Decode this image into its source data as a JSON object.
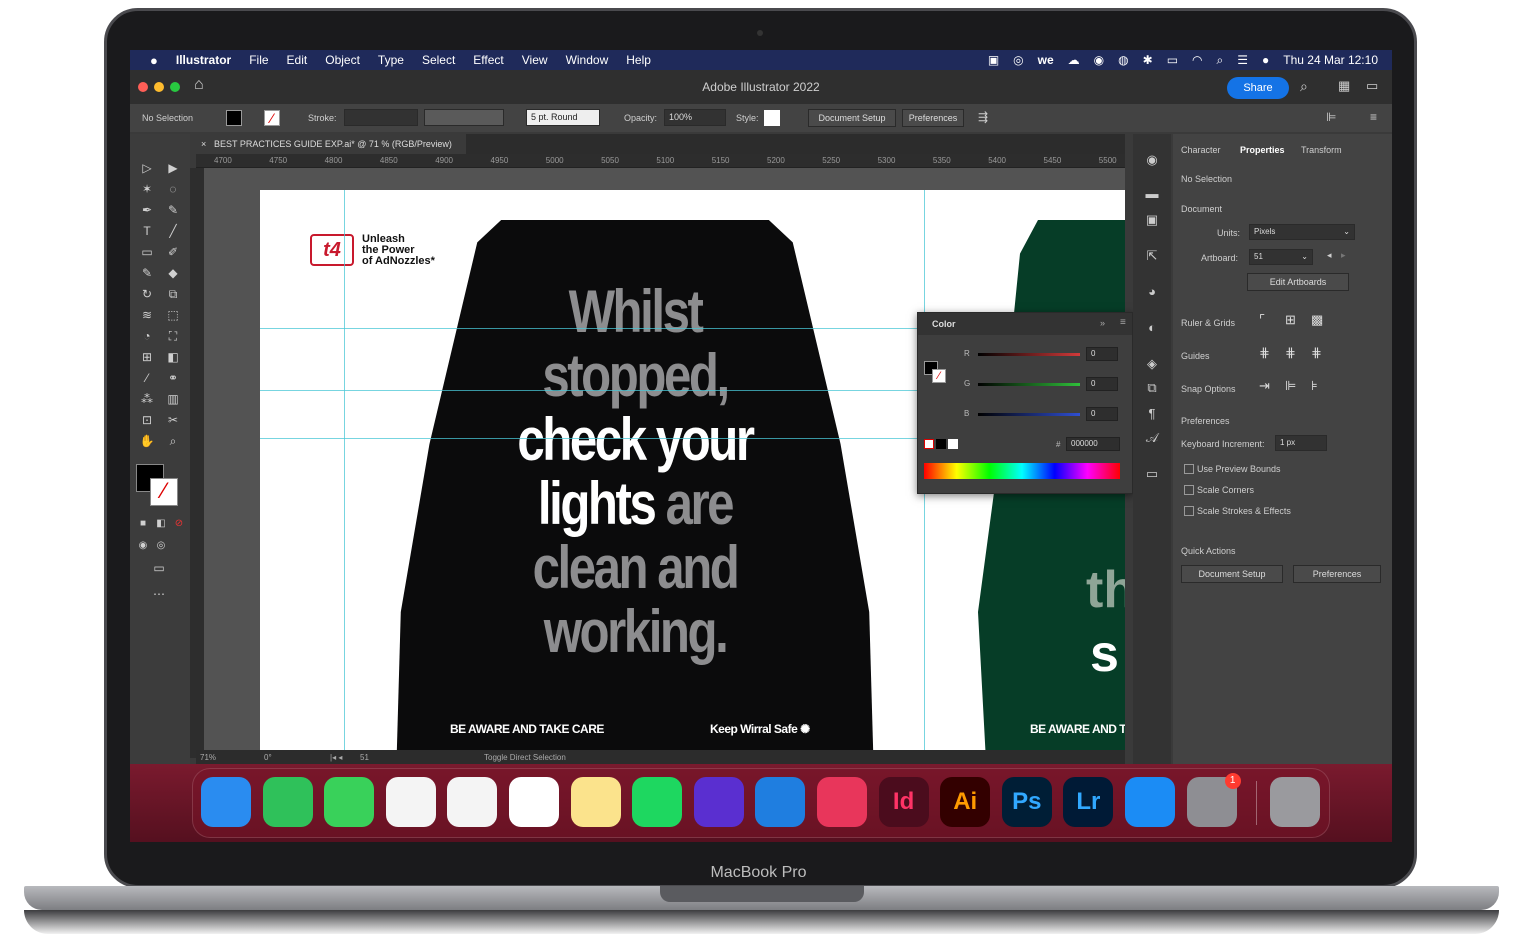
{
  "device": {
    "brand_label": "MacBook Pro"
  },
  "menubar": {
    "apple": "",
    "items": [
      "Illustrator",
      "File",
      "Edit",
      "Object",
      "Type",
      "Select",
      "Effect",
      "View",
      "Window",
      "Help"
    ],
    "datetime": "Thu 24 Mar  12:10"
  },
  "titlebar": {
    "title": "Adobe Illustrator 2022",
    "share_label": "Share"
  },
  "control_bar": {
    "selection": "No Selection",
    "stroke_label": "Stroke:",
    "brush": "5 pt. Round",
    "opacity_label": "Opacity:",
    "opacity_value": "100%",
    "style_label": "Style:",
    "document_setup": "Document Setup",
    "preferences": "Preferences"
  },
  "document_tab": {
    "title": "BEST PRACTICES GUIDE EXP.ai* @ 71 % (RGB/Preview)"
  },
  "ruler_ticks": [
    "4700",
    "4750",
    "4800",
    "4850",
    "4900",
    "4950",
    "5000",
    "5050",
    "5100",
    "5150",
    "5200",
    "5250",
    "5300",
    "5350",
    "5400",
    "5450",
    "5500"
  ],
  "artwork": {
    "logo_mark": "t4",
    "logo_text": [
      "Unleash",
      "the Power",
      "of AdNozzles*"
    ],
    "headline_grey1": "Whilst",
    "headline_grey2": "stopped,",
    "headline_white1": "check your",
    "headline_white2a": "lights",
    "headline_grey3": " are",
    "headline_grey4": "clean and",
    "headline_grey5": "working.",
    "tagline_left": "BE AWARE AND TAKE CARE",
    "tagline_right": "Keep Wirral Safe",
    "second_tagline": "BE AWARE AND TA",
    "second_partial": [
      "th",
      "s"
    ]
  },
  "color_panel": {
    "title": "Color",
    "channels": [
      {
        "label": "R",
        "value": "0"
      },
      {
        "label": "G",
        "value": "0"
      },
      {
        "label": "B",
        "value": "0"
      }
    ],
    "hex_label": "#",
    "hex_value": "000000",
    "colors": {
      "r": "#d23a3a",
      "g": "#2fbf3a",
      "b": "#2f4fd2"
    }
  },
  "properties": {
    "tabs": [
      "Character",
      "Properties",
      "Transform"
    ],
    "no_selection": "No Selection",
    "document": "Document",
    "units_label": "Units:",
    "units_value": "Pixels",
    "artboard_label": "Artboard:",
    "artboard_value": "51",
    "edit_artboards": "Edit Artboards",
    "ruler_grids": "Ruler & Grids",
    "guides": "Guides",
    "snap_options": "Snap Options",
    "preferences": "Preferences",
    "keyboard_increment_label": "Keyboard Increment:",
    "keyboard_increment_value": "1 px",
    "checkbox_preview": "Use Preview Bounds",
    "checkbox_corners": "Scale Corners",
    "checkbox_strokes": "Scale Strokes & Effects",
    "quick_actions": "Quick Actions",
    "qa_document_setup": "Document Setup",
    "qa_preferences": "Preferences"
  },
  "statusbar": {
    "zoom": "71%",
    "rotation": "0°",
    "artboard": "51",
    "hint": "Toggle Direct Selection"
  },
  "dock": {
    "apps": [
      {
        "name": "finder-icon",
        "label": "",
        "color": "#2a8cf0"
      },
      {
        "name": "facetime-icon",
        "label": "",
        "color": "#2fc15a"
      },
      {
        "name": "messages-icon",
        "label": "",
        "color": "#39d15a"
      },
      {
        "name": "photos-icon",
        "label": "",
        "color": "#f4f4f4"
      },
      {
        "name": "chrome-icon",
        "label": "",
        "color": "#f4f4f4"
      },
      {
        "name": "slack-icon",
        "label": "",
        "color": "#ffffff"
      },
      {
        "name": "notes-icon",
        "label": "",
        "color": "#fbe38c"
      },
      {
        "name": "spotify-icon",
        "label": "",
        "color": "#1ed760"
      },
      {
        "name": "cloud-app-icon",
        "label": "",
        "color": "#5a2fd0"
      },
      {
        "name": "trello-icon",
        "label": "",
        "color": "#1f7ee0"
      },
      {
        "name": "creative-cloud-icon",
        "label": "",
        "color": "#e8365b"
      },
      {
        "name": "indesign-icon",
        "label": "Id",
        "color": "#4b0c1d"
      },
      {
        "name": "illustrator-icon",
        "label": "Ai",
        "color": "#330000"
      },
      {
        "name": "photoshop-icon",
        "label": "Ps",
        "color": "#001e36"
      },
      {
        "name": "lightroom-icon",
        "label": "Lr",
        "color": "#001a36"
      },
      {
        "name": "app-store-icon",
        "label": "",
        "color": "#1b8cf5"
      },
      {
        "name": "system-preferences-icon",
        "label": "",
        "color": "#8e8e93"
      },
      {
        "name": "trash-icon",
        "label": "",
        "color": "#9a9a9e"
      }
    ],
    "settings_badge": "1"
  }
}
